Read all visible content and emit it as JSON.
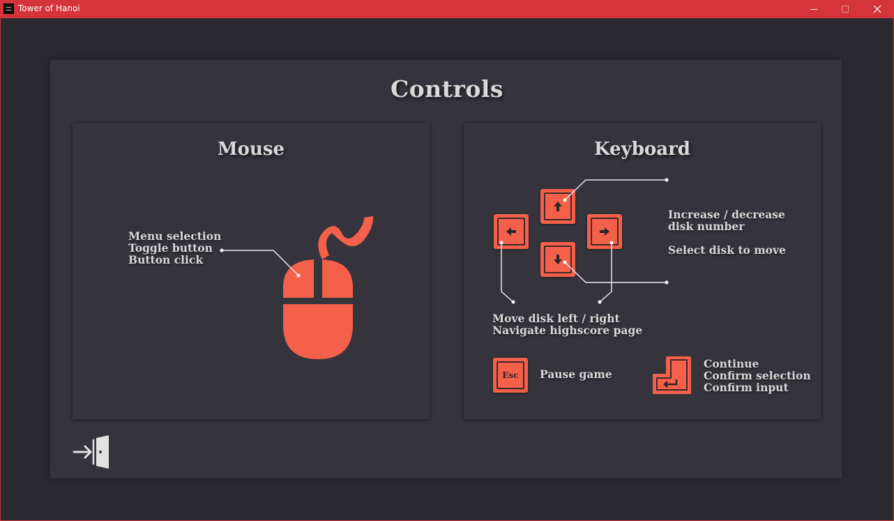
{
  "window": {
    "title": "Tower of Hanoi",
    "accent_color": "#d6343b"
  },
  "page": {
    "title": "Controls"
  },
  "mouse": {
    "title": "Mouse",
    "lines": [
      "Menu selection",
      "Toggle button",
      "Button click"
    ],
    "icon": "mouse-icon",
    "color": "#f4604a"
  },
  "keyboard": {
    "title": "Keyboard",
    "up_down_lines": [
      "Increase / decrease",
      "disk number"
    ],
    "select_line": "Select disk to move",
    "left_right_lines": [
      "Move disk left / right",
      "Navigate highscore page"
    ],
    "esc_key_label": "Esc",
    "esc_action": "Pause game",
    "enter_lines": [
      "Continue",
      "Confirm selection",
      "Confirm input"
    ],
    "key_color": "#f4604a"
  },
  "footer": {
    "exit_icon": "exit-door-icon"
  }
}
